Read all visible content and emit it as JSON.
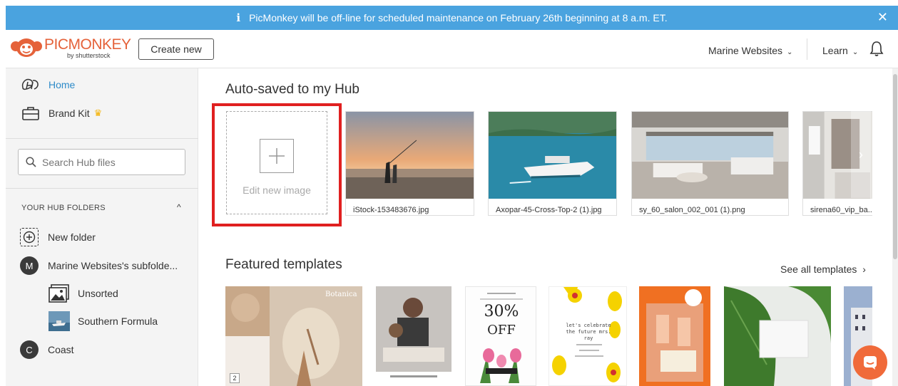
{
  "banner": {
    "info_icon": "i",
    "message": "PicMonkey will be off-line for scheduled maintenance on February 26th beginning at 8 a.m. ET.",
    "close_icon": "✕"
  },
  "header": {
    "logo_brand": "PICMONKEY",
    "logo_sub": "by shutterstock",
    "create_new_label": "Create new",
    "account_label": "Marine Websites",
    "learn_label": "Learn",
    "chevron": "⌄"
  },
  "sidebar": {
    "home_label": "Home",
    "brand_kit_label": "Brand Kit",
    "crown": "♛",
    "search_placeholder": "Search Hub files",
    "folders_header": "YOUR HUB FOLDERS",
    "folders_chevron": "^",
    "new_folder_label": "New folder",
    "folders": [
      {
        "initial": "M",
        "label": "Marine Websites's subfolde..."
      },
      {
        "label": "Unsorted"
      },
      {
        "label": "Southern Formula"
      },
      {
        "initial": "C",
        "label": "Coast"
      }
    ]
  },
  "main": {
    "autosaved_title": "Auto-saved to my Hub",
    "edit_new_label": "Edit new image",
    "hub_files": [
      {
        "caption": "iStock-153483676.jpg"
      },
      {
        "caption": "Axopar-45-Cross-Top-2 (1).jpg"
      },
      {
        "caption": "sy_60_salon_002_001 (1).png"
      },
      {
        "caption": "sirena60_vip_ba..."
      }
    ],
    "next_arrow": "›",
    "featured_title": "Featured templates",
    "see_all_label": "See all templates",
    "see_all_arrow": "›",
    "template_badge": "2",
    "templates": [
      {
        "name": "botanica-template",
        "title": "Botanica"
      },
      {
        "name": "family-dinner-template"
      },
      {
        "name": "sale-template",
        "big": "30%",
        "sub": "OFF"
      },
      {
        "name": "bridal-shower-template",
        "text": "let's celebrate the future mrs. ray"
      },
      {
        "name": "drinks-template"
      },
      {
        "name": "leaf-card-template"
      },
      {
        "name": "building-template"
      }
    ]
  },
  "colors": {
    "banner": "#4aa3df",
    "accent_orange": "#e5623a",
    "home_blue": "#2e8bc9",
    "highlight_red": "#e02020"
  }
}
